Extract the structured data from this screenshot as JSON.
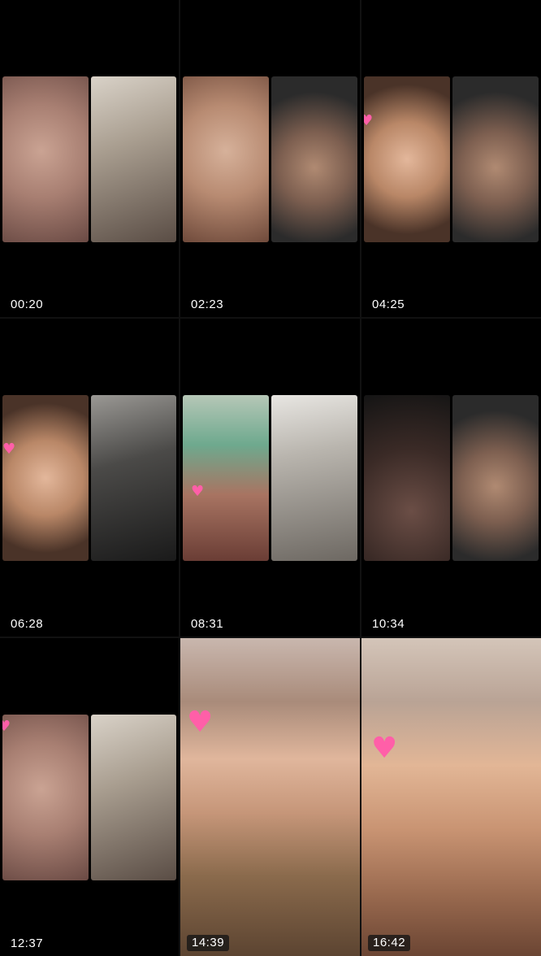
{
  "grid": {
    "tiles": [
      {
        "timestamp": "00:20",
        "layout": "split",
        "heart": false,
        "left_pane": "close-up-face",
        "right_pane": "smiling-face-room"
      },
      {
        "timestamp": "02:23",
        "layout": "split",
        "heart": false,
        "left_pane": "close-up-mouth",
        "right_pane": "man-purple-headscarf"
      },
      {
        "timestamp": "04:25",
        "layout": "split",
        "heart": true,
        "left_pane": "girl-with-braces",
        "right_pane": "man-purple-headscarf"
      },
      {
        "timestamp": "06:28",
        "layout": "split",
        "heart": true,
        "left_pane": "girl-frowning",
        "right_pane": "dark-room"
      },
      {
        "timestamp": "08:31",
        "layout": "split",
        "heart": true,
        "left_pane": "girl-with-teddy-bear",
        "right_pane": "room-shelf"
      },
      {
        "timestamp": "10:34",
        "layout": "split",
        "heart": false,
        "left_pane": "dim-face",
        "right_pane": "man-purple-headscarf"
      },
      {
        "timestamp": "12:37",
        "layout": "split",
        "heart": true,
        "left_pane": "close-up-face",
        "right_pane": "man-in-room"
      },
      {
        "timestamp": "14:39",
        "layout": "full",
        "heart": true,
        "subject": "girl-selfie"
      },
      {
        "timestamp": "16:42",
        "layout": "full",
        "heart": true,
        "subject": "girl-covering-mouth"
      }
    ]
  },
  "colors": {
    "background": "#000000",
    "timestamp_text": "#ffffff",
    "heart": "#ff5fa8"
  },
  "icons": {
    "heart": "heart-icon"
  }
}
